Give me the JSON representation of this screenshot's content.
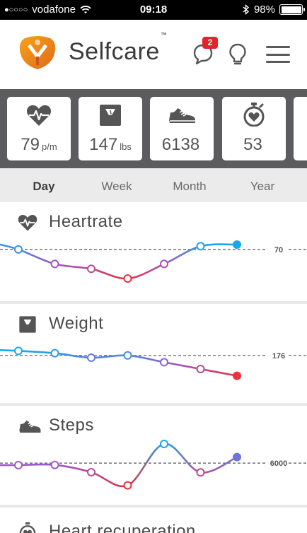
{
  "status_bar": {
    "carrier": "vodafone",
    "signal_dots": "●○○○○",
    "time": "09:18",
    "battery": "98%"
  },
  "header": {
    "app_name": "Selfcare",
    "trademark": "™",
    "message_count": "2"
  },
  "metrics": [
    {
      "icon": "heart-icon",
      "value": "79",
      "unit": "p/m"
    },
    {
      "icon": "scale-icon",
      "value": "147",
      "unit": "lbs"
    },
    {
      "icon": "sneaker-icon",
      "value": "6138",
      "unit": ""
    },
    {
      "icon": "stopwatch-heart-icon",
      "value": "53",
      "unit": ""
    }
  ],
  "tabs": {
    "items": [
      "Day",
      "Week",
      "Month",
      "Year"
    ],
    "active": "Day"
  },
  "cards": [
    {
      "title": "Heartrate",
      "icon": "heart-icon",
      "reference_label": "70",
      "chart_data": {
        "type": "line",
        "reference": 70,
        "x": [
          0,
          1,
          2,
          3,
          4,
          5,
          6
        ],
        "values": [
          70,
          61,
          58,
          52,
          61,
          72,
          73
        ]
      }
    },
    {
      "title": "Weight",
      "icon": "scale-icon",
      "reference_label": "176",
      "chart_data": {
        "type": "line",
        "reference": 176,
        "x": [
          0,
          1,
          2,
          3,
          4,
          5,
          6
        ],
        "values": [
          178,
          177,
          175,
          176,
          173,
          170,
          167
        ]
      }
    },
    {
      "title": "Steps",
      "icon": "sneaker-icon",
      "reference_label": "6000",
      "chart_data": {
        "type": "line",
        "reference": 6000,
        "x": [
          0,
          1,
          2,
          3,
          4,
          5,
          6
        ],
        "values": [
          5900,
          5910,
          5550,
          4900,
          6950,
          5540,
          6300
        ]
      }
    },
    {
      "title": "Heart recuperation",
      "icon": "stopwatch-heart-icon",
      "reference_label": "",
      "chart_data": null
    }
  ],
  "colors": {
    "accent_blue": "#1aa7ec",
    "accent_purple": "#9b59d0",
    "accent_red": "#e8343c",
    "logo_orange": "#f08a1c",
    "strip_bg": "#5c5c5f"
  }
}
